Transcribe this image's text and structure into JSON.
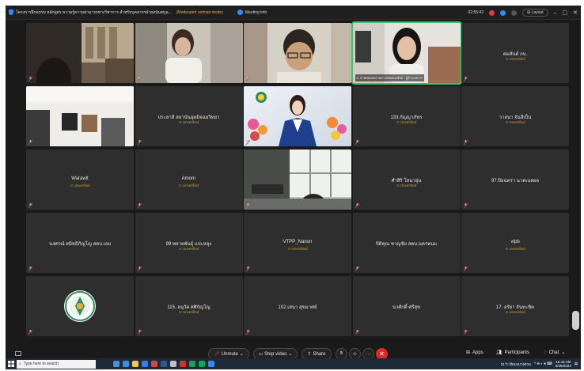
{
  "window": {
    "title": "โครงการฝึกอบรม หลักสูตร ความรู้ความสามารถทางวิชาการ สำหรับบุคลากรฝ่ายสนับสนุน...",
    "moderated": "(Moderated unmute mode)",
    "meeting_info": "Meeting info",
    "timer": "02:55:42",
    "layout_label": "Layout"
  },
  "tiles": [
    {
      "id": "t1",
      "kind": "video",
      "scene": "office"
    },
    {
      "id": "t2",
      "kind": "video",
      "scene": "woman"
    },
    {
      "id": "t3",
      "kind": "video",
      "scene": "glasses-man"
    },
    {
      "id": "t4",
      "kind": "video",
      "scene": "speaker",
      "label": "3. สายพลอยทรายยาวบันทองเช้อม - ผู้อำนวยการ",
      "active": true
    },
    {
      "id": "t5",
      "kind": "name",
      "name": "คมสันต์ กบ.",
      "status": "Unverified"
    },
    {
      "id": "t6",
      "kind": "video",
      "scene": "room"
    },
    {
      "id": "t7",
      "kind": "name",
      "name": "ประสาสิ สถาบันอุดมิจฉยวิทยา",
      "status": "Unverified"
    },
    {
      "id": "t8",
      "kind": "video",
      "scene": "presenter"
    },
    {
      "id": "t9",
      "kind": "name",
      "name": "133.กัญญาภัทร",
      "status": "Unverified"
    },
    {
      "id": "t10",
      "kind": "name",
      "name": "วาสนา จันสีเป็น",
      "status": "Unverified"
    },
    {
      "id": "t11",
      "kind": "name",
      "name": "Warawit",
      "status": "Unverified"
    },
    {
      "id": "t12",
      "kind": "name",
      "name": "Amorn",
      "status": "Unverified"
    },
    {
      "id": "t13",
      "kind": "video",
      "scene": "window-room"
    },
    {
      "id": "t14",
      "kind": "name",
      "name": "ศำสิริ โสนาอุ่น",
      "status": "Unverified"
    },
    {
      "id": "t15",
      "kind": "name",
      "name": "97.ปิยฉตรา นาคเนยผล",
      "status": ""
    },
    {
      "id": "t16",
      "kind": "name",
      "name": "นงศรณ์ สมิทธิภิญโญ สคบ.เลย",
      "status": ""
    },
    {
      "id": "t17",
      "kind": "name",
      "name": "99 พลายพันธุ์ แปะหลุง",
      "status": "Unverified"
    },
    {
      "id": "t18",
      "kind": "name",
      "name": "VTPP_Nanon",
      "status": "Unverified"
    },
    {
      "id": "t19",
      "kind": "name",
      "name": "ปิติคุณ ชาญชัย สคบ.นครพนม",
      "status": ""
    },
    {
      "id": "t20",
      "kind": "name",
      "name": "vtpb",
      "status": "Unverified"
    },
    {
      "id": "t21",
      "kind": "logo"
    },
    {
      "id": "t22",
      "kind": "name",
      "name": "115. อนุวัต ศศิกัญโญ",
      "status": "Unverified"
    },
    {
      "id": "t23",
      "kind": "name",
      "name": "102.เสนา สุขมาศย์",
      "status": ""
    },
    {
      "id": "t24",
      "kind": "name",
      "name": "นวศักดิ์ ศรีสุข",
      "status": ""
    },
    {
      "id": "t25",
      "kind": "name",
      "name": "17. อรัยา จันทะชิต",
      "status": "Unverified"
    }
  ],
  "toolbar": {
    "unmute": "Unmute",
    "stop_video": "Stop video",
    "share": "Share",
    "apps": "Apps",
    "participants": "Participants",
    "chat": "Chat"
  },
  "taskbar": {
    "search_placeholder": "Type here to search",
    "weather": "31°C มีเมฆบางส่วน",
    "time": "16:43 AM",
    "date": "5/26/2024"
  },
  "colors": {
    "accent": "#2d8cff",
    "unverified": "#d39b2c",
    "active_border": "#35c46a",
    "leave": "#e02828"
  }
}
